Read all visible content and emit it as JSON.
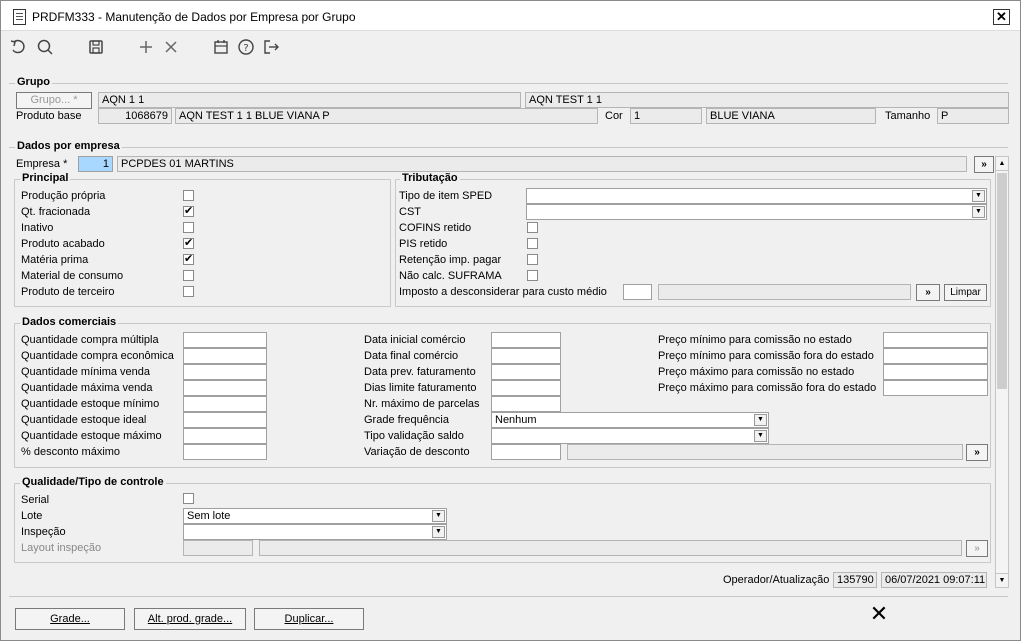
{
  "window": {
    "title": "PRDFM333 - Manutenção de Dados por Empresa por Grupo",
    "close_glyph": "✕"
  },
  "toolbar": {
    "icons": [
      "undo-icon",
      "search-icon",
      "save-icon",
      "add-icon",
      "delete-icon",
      "calendar-icon",
      "help-icon",
      "exit-icon"
    ]
  },
  "grupo": {
    "title": "Grupo",
    "grupo_button": "Grupo... *",
    "grupo_code": "AQN 1 1",
    "grupo_desc": "AQN TEST 1 1",
    "produto_base_label": "Produto base",
    "produto_base_code": "1068679",
    "produto_base_desc": "AQN TEST 1 1 BLUE VIANA P",
    "cor_label": "Cor",
    "cor_code": "1",
    "cor_desc": "BLUE VIANA",
    "tamanho_label": "Tamanho",
    "tamanho_value": "P"
  },
  "empresa": {
    "title": "Dados por empresa",
    "label": "Empresa *",
    "code": "1",
    "desc": "PCPDES 01 MARTINS",
    "nav_glyph": "»"
  },
  "principal": {
    "title": "Principal",
    "items": [
      {
        "label": "Produção própria",
        "checked": false,
        "mark": ""
      },
      {
        "label": "Qt. fracionada",
        "checked": true,
        "mark": "✔"
      },
      {
        "label": "Inativo",
        "checked": false,
        "mark": ""
      },
      {
        "label": "Produto acabado",
        "checked": true,
        "mark": "✔"
      },
      {
        "label": "Matéria prima",
        "checked": true,
        "mark": "✔"
      },
      {
        "label": "Material de consumo",
        "checked": false,
        "mark": ""
      },
      {
        "label": "Produto de terceiro",
        "checked": false,
        "mark": ""
      }
    ]
  },
  "tributacao": {
    "title": "Tributação",
    "tipo_item_label": "Tipo de item SPED",
    "tipo_item_value": "",
    "cst_label": "CST",
    "cst_value": "",
    "cofins_label": "COFINS retido",
    "pis_label": "PIS retido",
    "retencao_label": "Retenção imp. pagar",
    "suframa_label": "Não calc. SUFRAMA",
    "imposto_label": "Imposto a desconsiderar para custo médio",
    "imposto_value": "",
    "nav_glyph": "»",
    "limpar": "Limpar"
  },
  "comerciais": {
    "title": "Dados comerciais",
    "col1": [
      "Quantidade compra múltipla",
      "Quantidade compra econômica",
      "Quantidade mínima venda",
      "Quantidade máxima venda",
      "Quantidade estoque mínimo",
      "Quantidade estoque ideal",
      "Quantidade estoque máximo",
      "% desconto máximo"
    ],
    "col2": [
      "Data inicial comércio",
      "Data final comércio",
      "Data prev. faturamento",
      "Dias limite faturamento",
      "Nr. máximo de parcelas",
      "Grade frequência",
      "Tipo validação saldo",
      "Variação de desconto"
    ],
    "col3": [
      "Preço mínimo para comissão no estado",
      "Preço mínimo para comissão fora do estado",
      "Preço máximo para comissão no estado",
      "Preço máximo para comissão fora do estado"
    ],
    "grade_frequencia_value": "Nenhum",
    "tipo_validacao_value": "",
    "nav_glyph": "»"
  },
  "qualidade": {
    "title": "Qualidade/Tipo de controle",
    "serial_label": "Serial",
    "lote_label": "Lote",
    "lote_value": "Sem lote",
    "inspecao_label": "Inspeção",
    "inspecao_value": "",
    "layout_label": "Layout inspeção",
    "nav_glyph": "»"
  },
  "status": {
    "operador_label": "Operador/Atualização",
    "operador_value": "135790",
    "timestamp": "06/07/2021 09:07:11"
  },
  "footer": {
    "grade": "Grade...",
    "alt_prod_grade": "Alt. prod. grade...",
    "duplicar": "Duplicar...",
    "cancel_glyph": "✕"
  }
}
